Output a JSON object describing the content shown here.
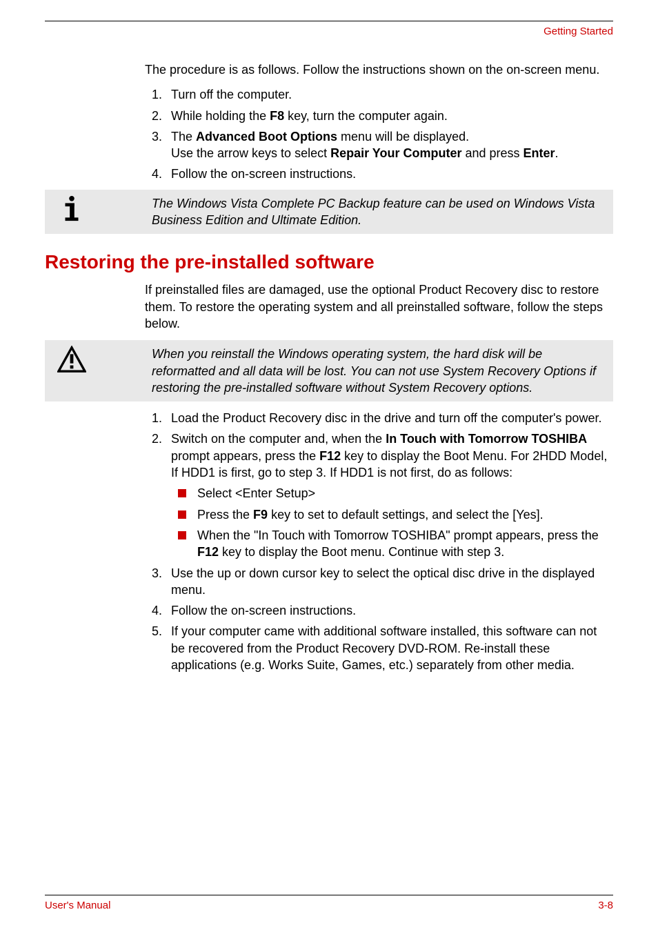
{
  "header": {
    "title": "Getting Started"
  },
  "intro": "The procedure is as follows. Follow the instructions shown on the on-screen menu.",
  "steps1": {
    "item1": "Turn off the computer.",
    "item2_prefix": "While holding the ",
    "item2_bold": "F8",
    "item2_suffix": " key, turn the computer again.",
    "item3_prefix": "The ",
    "item3_bold1": "Advanced Boot Options",
    "item3_mid1": " menu will be displayed.",
    "item3_line2_prefix": "Use the arrow keys to select ",
    "item3_bold2": "Repair Your Computer",
    "item3_mid2": " and press ",
    "item3_bold3": "Enter",
    "item3_suffix": ".",
    "item4": "Follow the on-screen instructions."
  },
  "note": "The Windows Vista Complete PC Backup feature can be used on Windows Vista Business Edition and Ultimate Edition.",
  "heading": "Restoring the pre-installed software",
  "para2": "If preinstalled files are damaged, use the optional Product Recovery disc to restore them. To restore the operating system and all preinstalled software, follow the steps below.",
  "warning": "When you reinstall the Windows operating system, the hard disk will be reformatted and all data will be lost. You can not use System Recovery Options if restoring the pre-installed software without System Recovery options.",
  "steps2": {
    "item1": "Load the Product Recovery disc in the drive and turn off the computer's power.",
    "item2_prefix": "Switch on the computer and, when the ",
    "item2_bold1": "In Touch with Tomorrow TOSHIBA",
    "item2_mid1": " prompt appears, press the ",
    "item2_bold2": "F12",
    "item2_suffix": " key to display the Boot Menu. For 2HDD Model, If HDD1 is first, go to step 3. If HDD1 is not first, do as follows:",
    "sub1": "Select <Enter Setup>",
    "sub2_prefix": "Press the ",
    "sub2_bold": "F9",
    "sub2_suffix": " key to set to default settings, and select the [Yes].",
    "sub3_prefix": "When the \"In Touch with Tomorrow TOSHIBA\" prompt appears, press the ",
    "sub3_bold": "F12",
    "sub3_suffix": " key to display the Boot menu. Continue with step 3.",
    "item3": "Use the up or down cursor key to select the optical disc drive in the displayed menu.",
    "item4": "Follow the on-screen instructions.",
    "item5": "If your computer came with additional software installed, this software can not be recovered from the Product Recovery DVD-ROM. Re-install these applications (e.g. Works Suite, Games, etc.) separately from other media."
  },
  "footer": {
    "left": "User's Manual",
    "right": "3-8"
  }
}
